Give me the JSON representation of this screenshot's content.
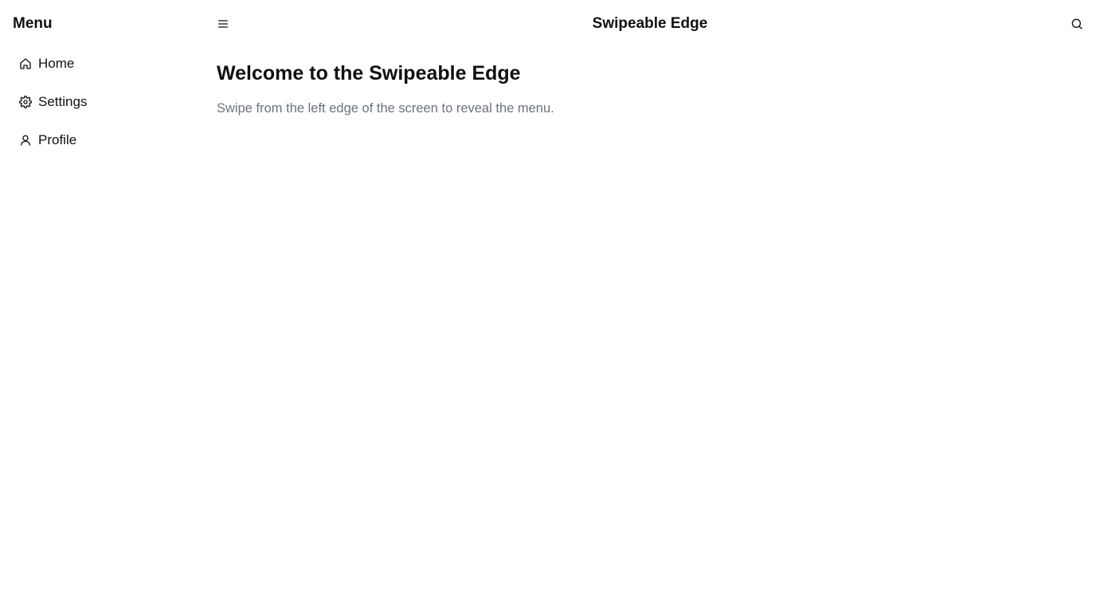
{
  "sidebar": {
    "title": "Menu",
    "items": [
      {
        "label": "Home",
        "icon": "home-icon"
      },
      {
        "label": "Settings",
        "icon": "gear-icon"
      },
      {
        "label": "Profile",
        "icon": "user-icon"
      }
    ]
  },
  "header": {
    "title": "Swipeable Edge",
    "menu_icon": "hamburger-icon",
    "search_icon": "search-icon"
  },
  "main": {
    "title": "Welcome to the Swipeable Edge",
    "subtitle": "Swipe from the left edge of the screen to reveal the menu."
  },
  "colors": {
    "background": "#ffffff",
    "text": "#111111",
    "muted": "#6b7280"
  }
}
